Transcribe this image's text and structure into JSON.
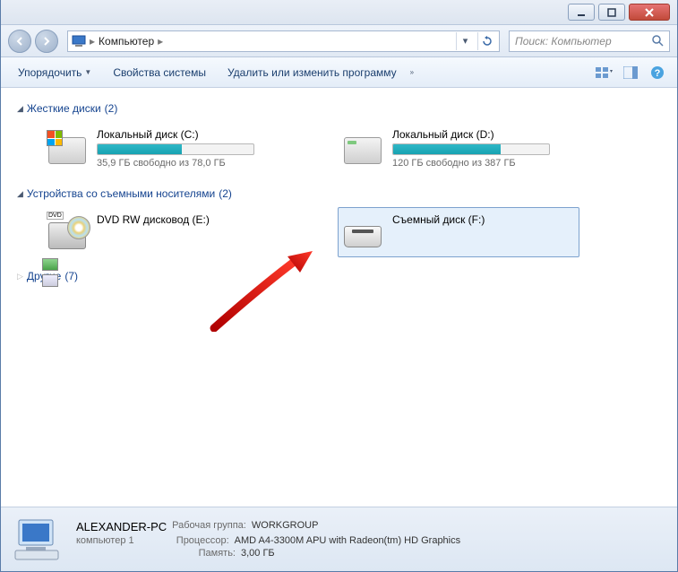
{
  "address": {
    "location": "Компьютер"
  },
  "search": {
    "placeholder": "Поиск: Компьютер"
  },
  "toolbar": {
    "organize": "Упорядочить",
    "properties": "Свойства системы",
    "uninstall": "Удалить или изменить программу"
  },
  "groups": {
    "hdd": {
      "label": "Жесткие диски",
      "count": "(2)"
    },
    "removable": {
      "label": "Устройства со съемными носителями",
      "count": "(2)"
    },
    "other": {
      "label": "Другие",
      "count": "(7)"
    }
  },
  "drives": {
    "c": {
      "name": "Локальный диск (C:)",
      "stat": "35,9 ГБ свободно из 78,0 ГБ",
      "fill_pct": 54
    },
    "d": {
      "name": "Локальный диск (D:)",
      "stat": "120 ГБ свободно из 387 ГБ",
      "fill_pct": 69
    },
    "e": {
      "name": "DVD RW дисковод (E:)"
    },
    "f": {
      "name": "Съемный диск (F:)"
    }
  },
  "status": {
    "computer_name": "ALEXANDER-PC",
    "workgroup_label": "Рабочая группа:",
    "workgroup": "WORKGROUP",
    "domain_label": "компьютер 1",
    "cpu_label": "Процессор:",
    "cpu": "AMD A4-3300M APU with Radeon(tm) HD Graphics",
    "mem_label": "Память:",
    "mem": "3,00 ГБ"
  }
}
